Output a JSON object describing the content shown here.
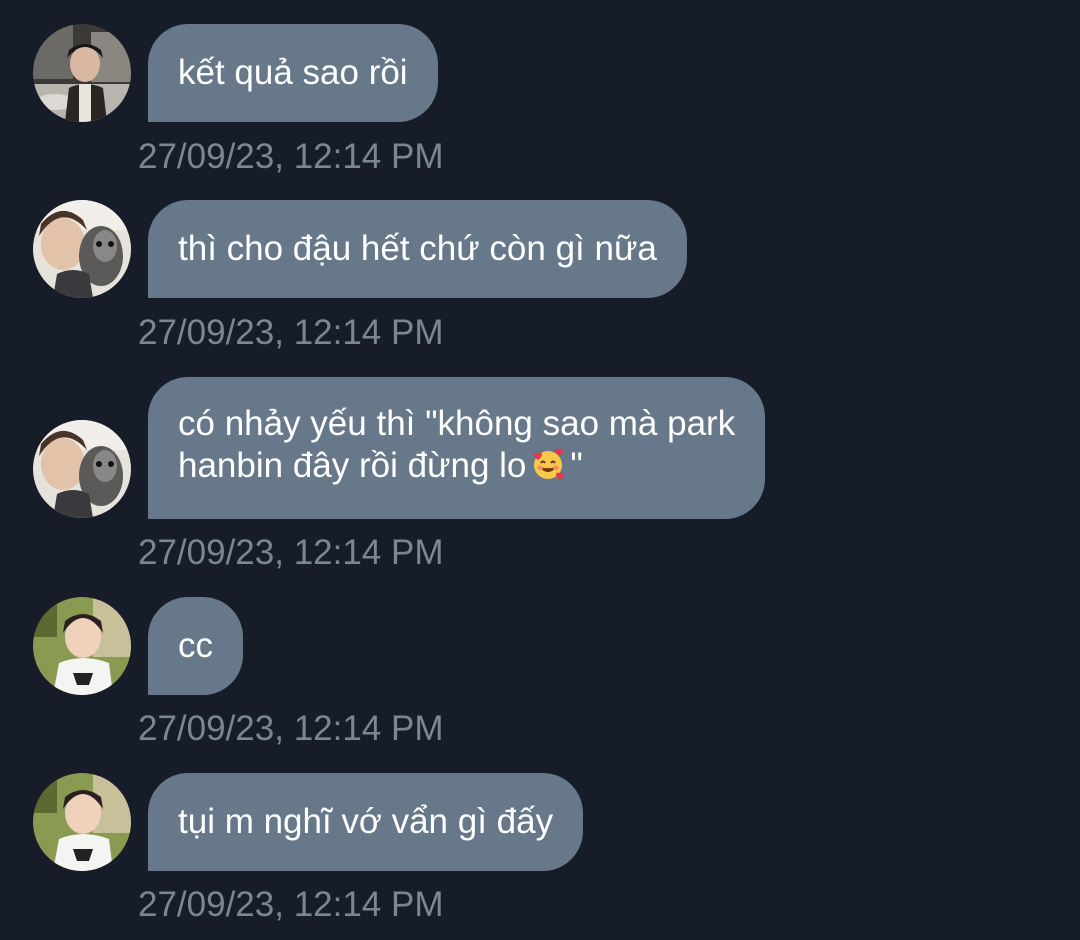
{
  "messages": [
    {
      "avatar_icon": "user-avatar-1",
      "lines": [
        "kết quả sao rồi"
      ],
      "timestamp": "27/09/23, 12:14 PM"
    },
    {
      "avatar_icon": "user-avatar-2",
      "lines": [
        "thì cho đậu hết chứ còn gì nữa"
      ],
      "timestamp": "27/09/23, 12:14 PM"
    },
    {
      "avatar_icon": "user-avatar-2",
      "lines": [
        "có nhảy yếu thì \"không sao mà park",
        "hanbin đây rồi đừng lo"
      ],
      "line2_suffix": "\"",
      "emoji_icon": "smiling-face-with-hearts-emoji",
      "timestamp": "27/09/23, 12:14 PM"
    },
    {
      "avatar_icon": "user-avatar-3",
      "lines": [
        "cc"
      ],
      "timestamp": "27/09/23, 12:14 PM"
    },
    {
      "avatar_icon": "user-avatar-3",
      "lines": [
        "tụi m nghĩ vớ vẩn gì đấy"
      ],
      "timestamp": "27/09/23, 12:14 PM"
    }
  ],
  "colors": {
    "background": "#161d28",
    "bubble": "#66788a",
    "bubble_text": "#ffffff",
    "timestamp": "#7a8694"
  }
}
